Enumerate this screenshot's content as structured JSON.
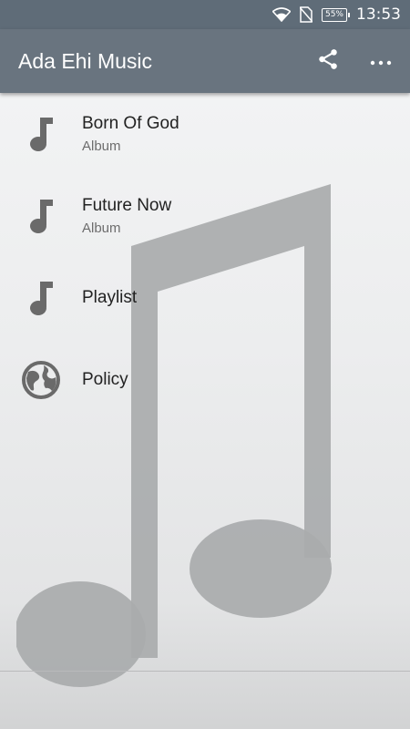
{
  "status_bar": {
    "battery_percent": "55%",
    "time": "13:53"
  },
  "app_bar": {
    "title": "Ada Ehi Music",
    "actions": [
      "share-icon",
      "more-vert-icon"
    ]
  },
  "list": {
    "items": [
      {
        "title": "Born Of God",
        "subtitle": "Album",
        "icon": "music-note-icon"
      },
      {
        "title": "Future Now",
        "subtitle": "Album",
        "icon": "music-note-icon"
      },
      {
        "title": "Playlist",
        "subtitle": "",
        "icon": "music-note-icon"
      },
      {
        "title": "Policy",
        "subtitle": "",
        "icon": "globe-icon"
      }
    ]
  },
  "colors": {
    "status_bar": "#5f6c78",
    "app_bar": "#69747f",
    "icon_gray": "#6a6a6a",
    "background_note": "#a8aaac"
  }
}
